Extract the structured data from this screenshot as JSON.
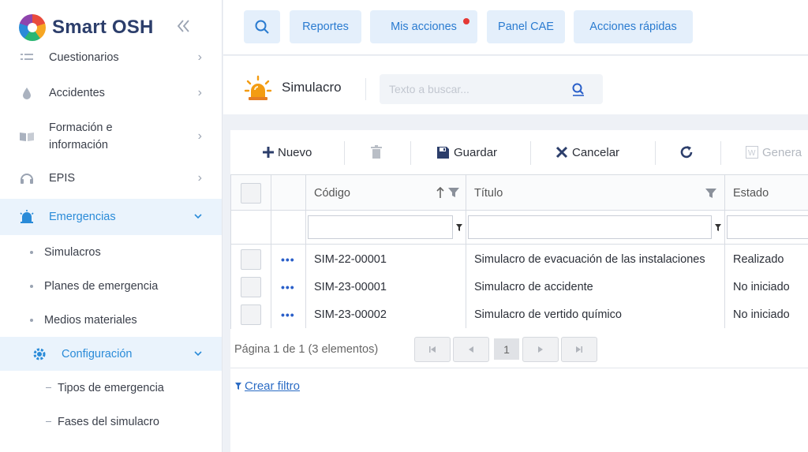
{
  "app": {
    "name": "Smart OSH"
  },
  "topbar": {
    "buttons": [
      {
        "label": "Reportes"
      },
      {
        "label": "Mis acciones"
      },
      {
        "label": "Panel CAE"
      },
      {
        "label": "Acciones rápidas"
      }
    ]
  },
  "sidebar": {
    "items": [
      {
        "label": "Cuestionarios",
        "icon": "list-icon"
      },
      {
        "label": "Accidentes",
        "icon": "drop-icon"
      },
      {
        "label": "Formación e",
        "label2": "información",
        "icon": "book-icon"
      },
      {
        "label": "EPIS",
        "icon": "headphones-icon"
      },
      {
        "label": "Emergencias",
        "icon": "alarm-icon"
      }
    ],
    "emergencias_sub": [
      {
        "label": "Simulacros"
      },
      {
        "label": "Planes de emergencia"
      },
      {
        "label": "Medios materiales"
      }
    ],
    "config": {
      "label": "Configuración"
    },
    "config_sub": [
      {
        "label": "Tipos de emergencia"
      },
      {
        "label": "Fases del simulacro"
      }
    ]
  },
  "page": {
    "title": "Simulacro",
    "search_placeholder": "Texto a buscar..."
  },
  "toolbar": {
    "nuevo": "Nuevo",
    "guardar": "Guardar",
    "cancelar": "Cancelar",
    "generar": "Genera"
  },
  "table": {
    "columns": {
      "codigo": "Código",
      "titulo": "Título",
      "estado": "Estado"
    },
    "rows": [
      {
        "codigo": "SIM-22-00001",
        "titulo": "Simulacro de evacuación de las instalaciones",
        "estado": "Realizado"
      },
      {
        "codigo": "SIM-23-00001",
        "titulo": "Simulacro de accidente",
        "estado": "No iniciado"
      },
      {
        "codigo": "SIM-23-00002",
        "titulo": "Simulacro de vertido químico",
        "estado": "No iniciado"
      }
    ],
    "row_menu": "•••"
  },
  "pager": {
    "text": "Página 1 de 1 (3 elementos)",
    "current": "1"
  },
  "filter_link": "Crear filtro",
  "colors": {
    "accent": "#2a8bd8",
    "active_bg": "#eaf3fc",
    "notif": "#e53935"
  }
}
